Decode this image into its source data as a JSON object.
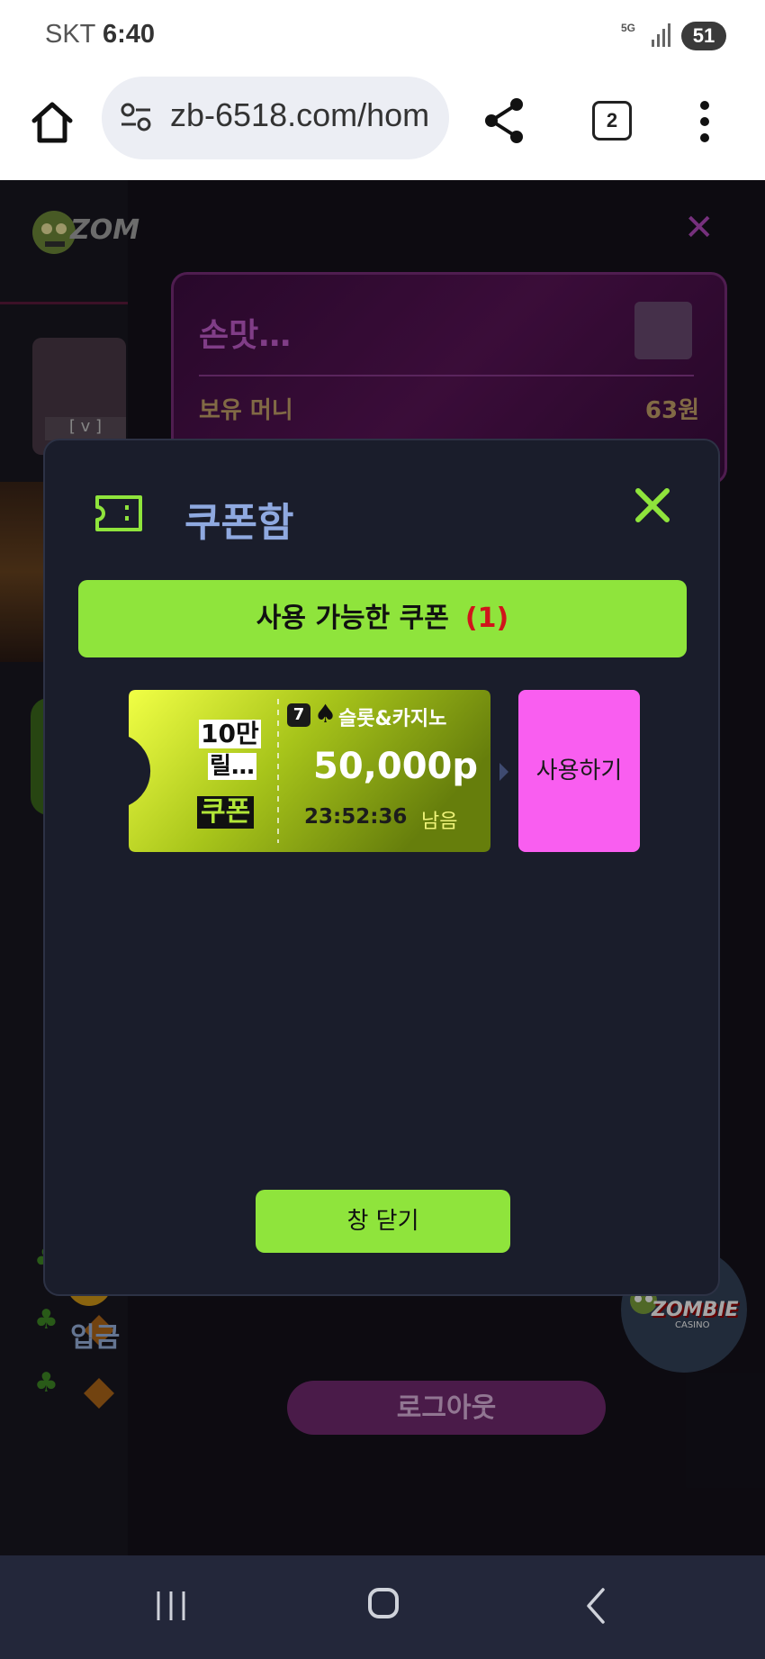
{
  "status_bar": {
    "carrier": "SKT",
    "time": "6:40",
    "network": "5G",
    "battery": "51"
  },
  "browser": {
    "url": "zb-6518.com/hom",
    "tab_count": "2"
  },
  "background": {
    "profile_name": "손맛…",
    "money_label": "보유 머니",
    "money_value": "63원",
    "level_badge": "[ v ]",
    "deposit_label": "입금",
    "logout_label": "로그아웃",
    "logo_word": "ZOM",
    "fab_logo": "ZOMBIE",
    "fab_logo_sub": "CASINO"
  },
  "modal": {
    "title": "쿠폰함",
    "tab_label": "사용 가능한 쿠폰",
    "tab_count": "(1)",
    "coupon": {
      "badge": "7",
      "category": "슬롯&카지노",
      "amount": "50,000p",
      "time_left": "23:52:36",
      "remain_label": "남음",
      "name_line1": "10만",
      "name_line2": "릴…",
      "name_line3": "쿠폰"
    },
    "use_button": "사용하기",
    "close_button": "창 닫기"
  }
}
